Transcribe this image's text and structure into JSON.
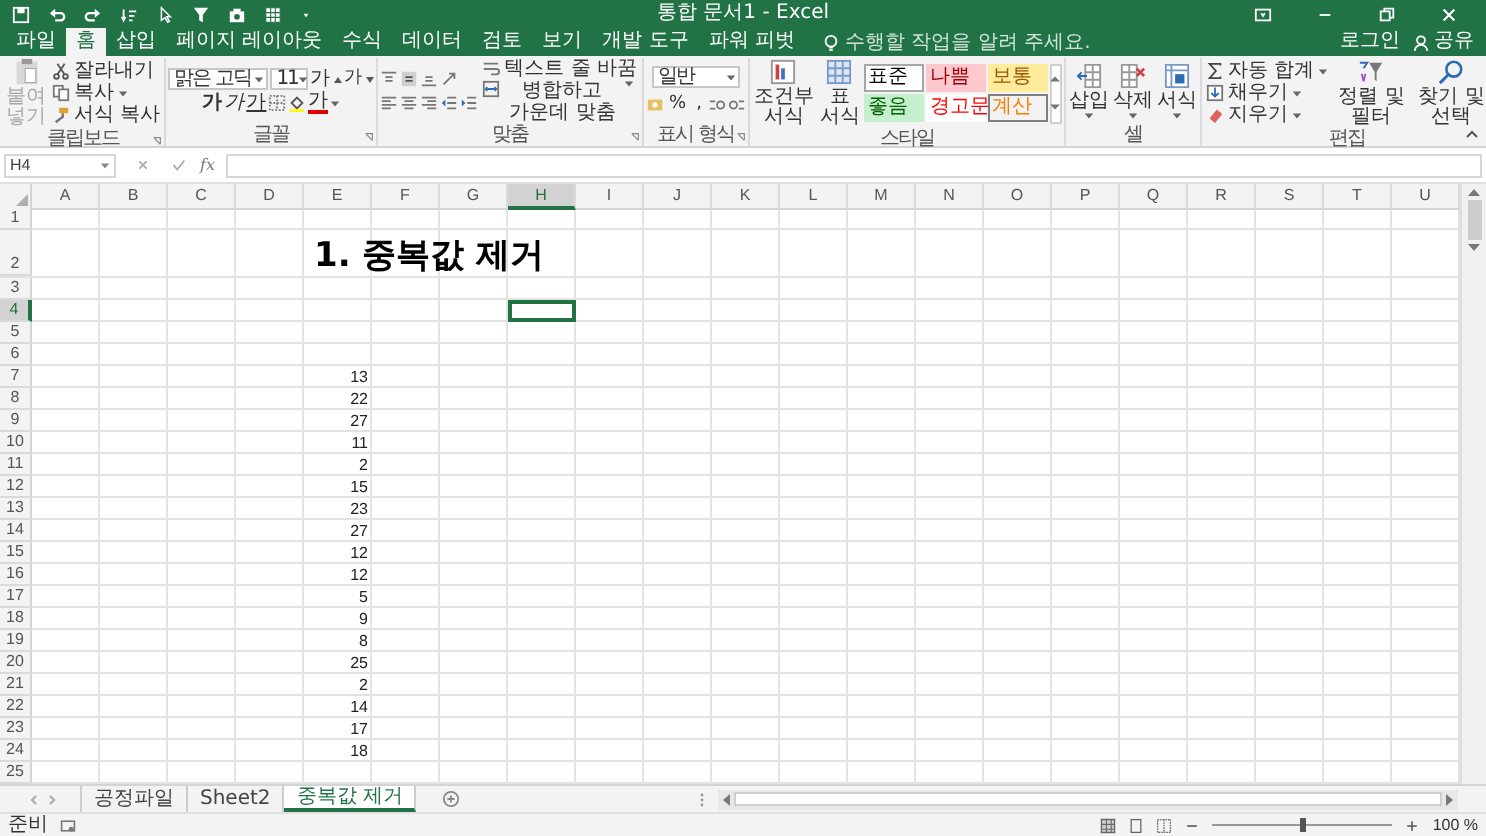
{
  "window": {
    "title": "통합 문서1 - Excel"
  },
  "tabs": [
    {
      "label": "파일",
      "selected": false
    },
    {
      "label": "홈",
      "selected": true
    },
    {
      "label": "삽입",
      "selected": false
    },
    {
      "label": "페이지 레이아웃",
      "selected": false
    },
    {
      "label": "수식",
      "selected": false
    },
    {
      "label": "데이터",
      "selected": false
    },
    {
      "label": "검토",
      "selected": false
    },
    {
      "label": "보기",
      "selected": false
    },
    {
      "label": "개발 도구",
      "selected": false
    },
    {
      "label": "파워 피벗",
      "selected": false
    }
  ],
  "tell_me": {
    "placeholder": "수행할 작업을 알려 주세요."
  },
  "account": {
    "sign_in": "로그인",
    "share": "공유"
  },
  "ribbon": {
    "clipboard": {
      "label": "클립보드",
      "paste": {
        "label": "붙여넣기",
        "disabled": true
      },
      "commands": [
        {
          "label": "잘라내기",
          "kind": "cut",
          "dropdown": false
        },
        {
          "label": "복사",
          "kind": "copy",
          "dropdown": true
        },
        {
          "label": "서식 복사",
          "kind": "painter",
          "dropdown": false
        }
      ]
    },
    "font": {
      "label": "글꼴",
      "font_name": "맑은 고딕",
      "font_size": "11",
      "grow": "가",
      "shrink": "가",
      "bold": "가",
      "italic": "가",
      "underline": "가",
      "font_color": "가"
    },
    "alignment": {
      "label": "맞춤",
      "wrap_text": "텍스트 줄 바꿈",
      "merge_center": "병합하고 가운데 맞춤"
    },
    "number": {
      "label": "표시 형식",
      "format": "일반",
      "percent": "%",
      "comma": ","
    },
    "styles": {
      "label": "스타일",
      "conditional": "조건부 서식",
      "format_table": "표 서식",
      "cell_styles": [
        {
          "label": "표준",
          "kind": "normal"
        },
        {
          "label": "나쁨",
          "kind": "bad"
        },
        {
          "label": "보통",
          "kind": "neutral"
        },
        {
          "label": "좋음",
          "kind": "good"
        },
        {
          "label": "경고문",
          "kind": "warning"
        },
        {
          "label": "계산",
          "kind": "calculation"
        }
      ]
    },
    "cells": {
      "label": "셀",
      "commands": [
        {
          "label": "삽입",
          "kind": "insert"
        },
        {
          "label": "삭제",
          "kind": "delete"
        },
        {
          "label": "서식",
          "kind": "format"
        }
      ]
    },
    "editing": {
      "label": "편집",
      "autosum": "자동 합계",
      "fill": "채우기",
      "clear": "지우기",
      "sort_filter": "정렬 및 필터",
      "find_select": "찾기 및 선택"
    }
  },
  "formula_bar": {
    "name_box": "H4",
    "function_label": "fx"
  },
  "columns": [
    {
      "label": "A",
      "selected": false
    },
    {
      "label": "B",
      "selected": false
    },
    {
      "label": "C",
      "selected": false
    },
    {
      "label": "D",
      "selected": false
    },
    {
      "label": "E",
      "selected": false
    },
    {
      "label": "F",
      "selected": false
    },
    {
      "label": "G",
      "selected": false
    },
    {
      "label": "H",
      "selected": true
    },
    {
      "label": "I",
      "selected": false
    },
    {
      "label": "J",
      "selected": false
    },
    {
      "label": "K",
      "selected": false
    },
    {
      "label": "L",
      "selected": false
    },
    {
      "label": "M",
      "selected": false
    },
    {
      "label": "N",
      "selected": false
    },
    {
      "label": "O",
      "selected": false
    },
    {
      "label": "P",
      "selected": false
    },
    {
      "label": "Q",
      "selected": false
    },
    {
      "label": "R",
      "selected": false
    },
    {
      "label": "S",
      "selected": false
    },
    {
      "label": "T",
      "selected": false
    },
    {
      "label": "U",
      "selected": false
    }
  ],
  "rows": [
    {
      "label": "1",
      "selected": false
    },
    {
      "label": "2",
      "selected": false,
      "title": "1. 중복값 제거"
    },
    {
      "label": "3",
      "selected": false
    },
    {
      "label": "4",
      "selected": true
    },
    {
      "label": "5",
      "selected": false
    },
    {
      "label": "6",
      "selected": false
    },
    {
      "label": "7",
      "selected": false,
      "column_e": "13"
    },
    {
      "label": "8",
      "selected": false,
      "column_e": "22"
    },
    {
      "label": "9",
      "selected": false,
      "column_e": "27"
    },
    {
      "label": "10",
      "selected": false,
      "column_e": "11"
    },
    {
      "label": "11",
      "selected": false,
      "column_e": "2"
    },
    {
      "label": "12",
      "selected": false,
      "column_e": "15"
    },
    {
      "label": "13",
      "selected": false,
      "column_e": "23"
    },
    {
      "label": "14",
      "selected": false,
      "column_e": "27"
    },
    {
      "label": "15",
      "selected": false,
      "column_e": "12"
    },
    {
      "label": "16",
      "selected": false,
      "column_e": "12"
    },
    {
      "label": "17",
      "selected": false,
      "column_e": "5"
    },
    {
      "label": "18",
      "selected": false,
      "column_e": "9"
    },
    {
      "label": "19",
      "selected": false,
      "column_e": "8"
    },
    {
      "label": "20",
      "selected": false,
      "column_e": "25"
    },
    {
      "label": "21",
      "selected": false,
      "column_e": "2"
    },
    {
      "label": "22",
      "selected": false,
      "column_e": "14"
    },
    {
      "label": "23",
      "selected": false,
      "column_e": "17"
    },
    {
      "label": "24",
      "selected": false,
      "column_e": "18"
    },
    {
      "label": "25",
      "selected": false
    }
  ],
  "sheet_tabs": [
    {
      "label": "공정파일",
      "selected": false
    },
    {
      "label": "Sheet2",
      "selected": false
    },
    {
      "label": "중복값 제거",
      "selected": true
    }
  ],
  "status_bar": {
    "mode": "준비",
    "zoom": "100 %",
    "zoom_slider": {
      "level": 0.5
    }
  }
}
